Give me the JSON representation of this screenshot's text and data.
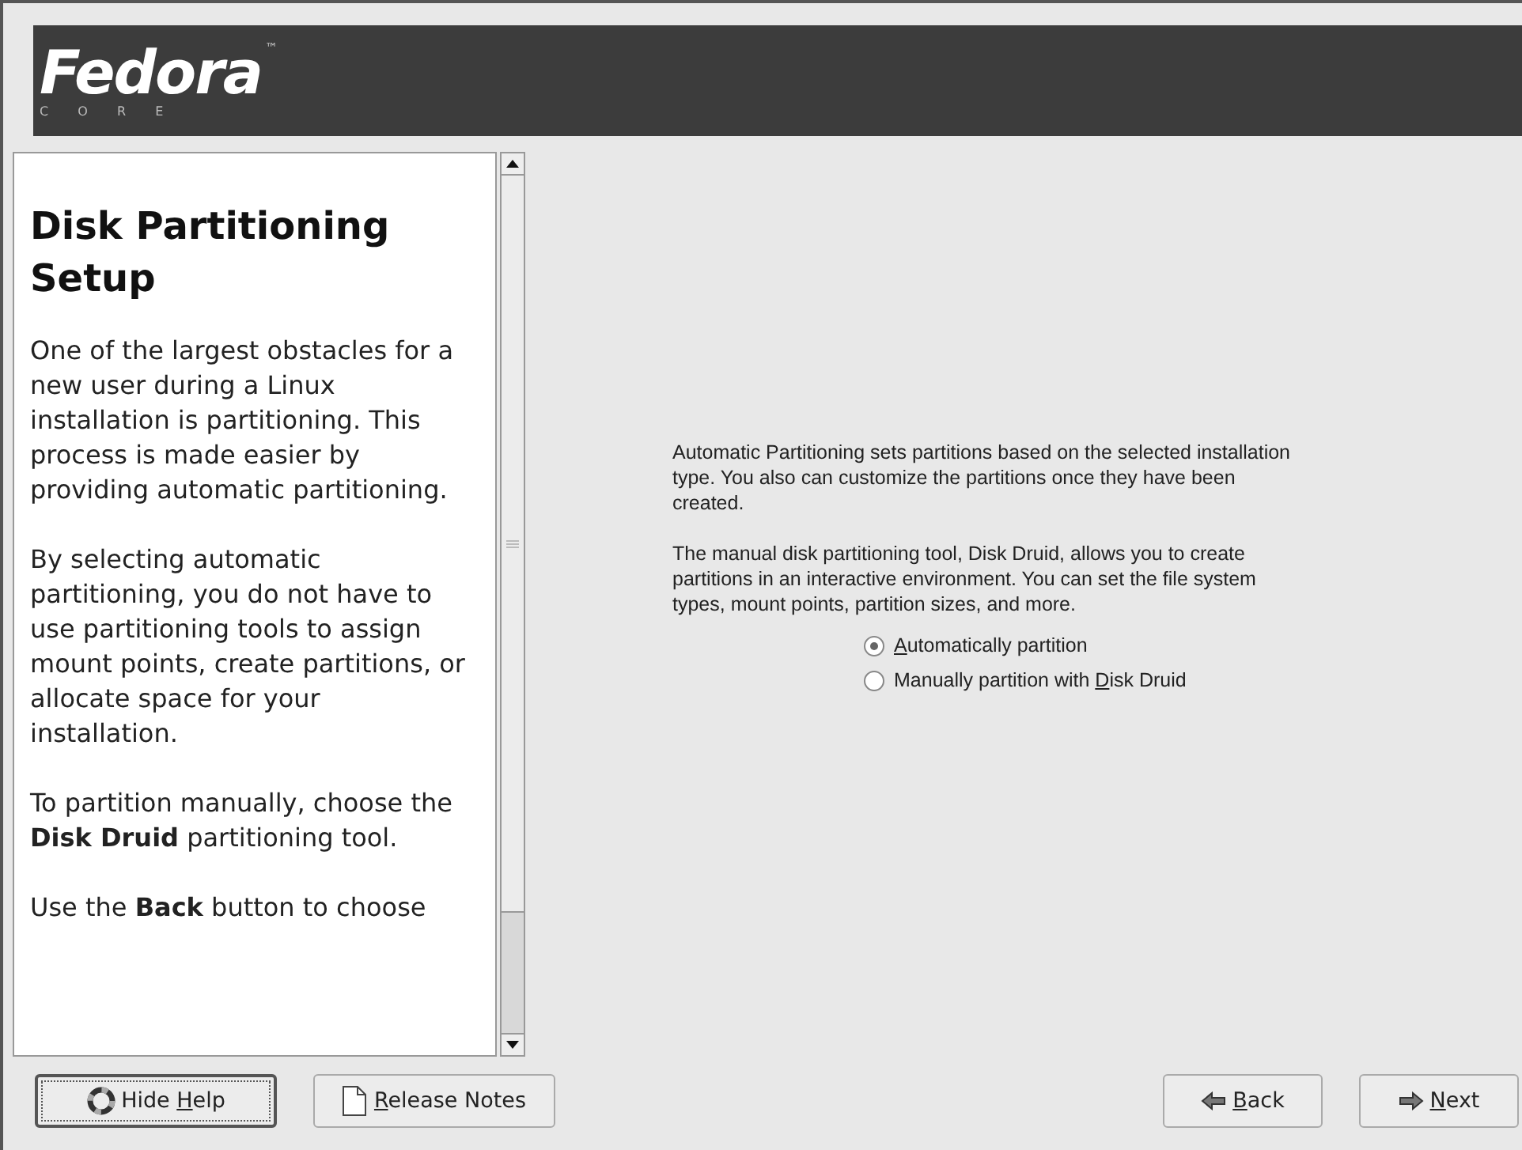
{
  "header": {
    "logo": "Fedora",
    "trademark": "™",
    "subtitle": "C O R E"
  },
  "help": {
    "title": "Disk Partitioning Setup",
    "paragraphs": [
      "One of the largest obstacles for a new user during a Linux installation is partitioning. This process is made easier by providing automatic partitioning.",
      "By selecting automatic partitioning, you do not have to use partitioning tools to assign mount points, create partitions, or allocate space for your installation.",
      "To partition manually, choose the **Disk Druid** partitioning tool.",
      "Use the **Back** button to choose"
    ]
  },
  "content": {
    "paragraphs": [
      "Automatic Partitioning sets partitions based on the selected installation type. You also can customize the partitions once they have been created.",
      "The manual disk partitioning tool, Disk Druid, allows you to create partitions in an interactive environment. You can set the file system types, mount points, partition sizes, and more."
    ],
    "options": [
      {
        "key": "A",
        "post": "utomatically partition",
        "selected": true
      },
      {
        "pre": "Manually partition with ",
        "key": "D",
        "post": "isk Druid",
        "selected": false
      }
    ]
  },
  "buttons": [
    {
      "kind": "help",
      "pre": "Hide ",
      "key": "H",
      "post": "elp"
    },
    {
      "kind": "notes",
      "key": "R",
      "post": "elease Notes"
    },
    {
      "kind": "back",
      "key": "B",
      "post": "ack"
    },
    {
      "kind": "next",
      "key": "N",
      "post": "ext"
    }
  ]
}
